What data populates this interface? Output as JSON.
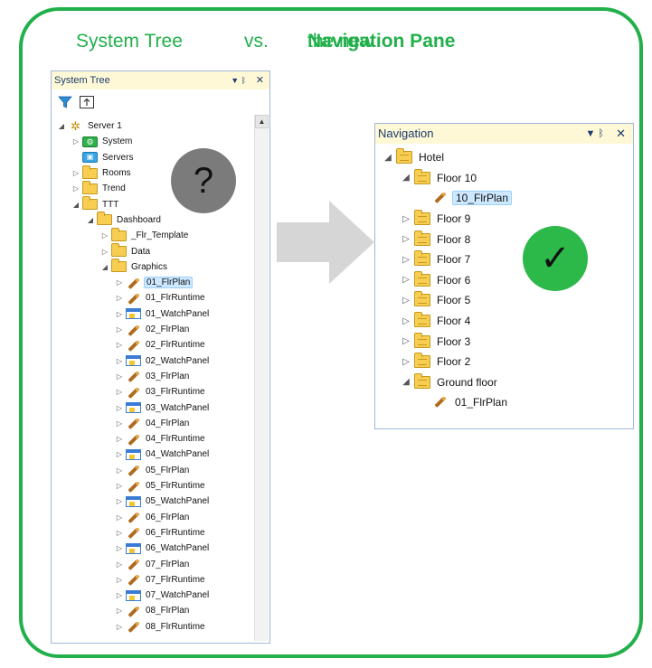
{
  "heading": {
    "left": "System Tree",
    "vs": "vs.",
    "right_prefix": "the new ",
    "right_bold": "Navigation Pane"
  },
  "colors": {
    "frame": "#22b04b",
    "check_badge": "#2db84a",
    "question_badge": "#7b7b7b",
    "arrow": "#d6d6d6"
  },
  "system_tree": {
    "title": "System Tree",
    "pin_glyph": "▼ ᛒ",
    "close_glyph": "✕",
    "toolbar": [
      {
        "icon": "filter-icon",
        "glyph": "▼"
      },
      {
        "icon": "export-icon",
        "glyph": "⇪"
      }
    ],
    "items": [
      {
        "label": "Server 1",
        "level": 0,
        "toggle": "◢",
        "icon": "server",
        "selected": false
      },
      {
        "label": "System",
        "level": 1,
        "toggle": "▷",
        "icon": "system",
        "selected": false
      },
      {
        "label": "Servers",
        "level": 1,
        "toggle": "",
        "icon": "servers",
        "selected": false
      },
      {
        "label": "Rooms",
        "level": 1,
        "toggle": "▷",
        "icon": "folder",
        "selected": false
      },
      {
        "label": "Trend",
        "level": 1,
        "toggle": "▷",
        "icon": "folder",
        "selected": false
      },
      {
        "label": "TTT",
        "level": 1,
        "toggle": "◢",
        "icon": "folder",
        "selected": false
      },
      {
        "label": "Dashboard",
        "level": 2,
        "toggle": "◢",
        "icon": "folder",
        "selected": false
      },
      {
        "label": "_Flr_Template",
        "level": 3,
        "toggle": "▷",
        "icon": "folder",
        "selected": false
      },
      {
        "label": "Data",
        "level": 3,
        "toggle": "▷",
        "icon": "folder",
        "selected": false
      },
      {
        "label": "Graphics",
        "level": 3,
        "toggle": "◢",
        "icon": "folder",
        "selected": false
      },
      {
        "label": "01_FlrPlan",
        "level": 4,
        "toggle": "▷",
        "icon": "plan",
        "selected": true
      },
      {
        "label": "01_FlrRuntime",
        "level": 4,
        "toggle": "▷",
        "icon": "plan",
        "selected": false
      },
      {
        "label": "01_WatchPanel",
        "level": 4,
        "toggle": "▷",
        "icon": "watch",
        "selected": false
      },
      {
        "label": "02_FlrPlan",
        "level": 4,
        "toggle": "▷",
        "icon": "plan",
        "selected": false
      },
      {
        "label": "02_FlrRuntime",
        "level": 4,
        "toggle": "▷",
        "icon": "plan",
        "selected": false
      },
      {
        "label": "02_WatchPanel",
        "level": 4,
        "toggle": "▷",
        "icon": "watch",
        "selected": false
      },
      {
        "label": "03_FlrPlan",
        "level": 4,
        "toggle": "▷",
        "icon": "plan",
        "selected": false
      },
      {
        "label": "03_FlrRuntime",
        "level": 4,
        "toggle": "▷",
        "icon": "plan",
        "selected": false
      },
      {
        "label": "03_WatchPanel",
        "level": 4,
        "toggle": "▷",
        "icon": "watch",
        "selected": false
      },
      {
        "label": "04_FlrPlan",
        "level": 4,
        "toggle": "▷",
        "icon": "plan",
        "selected": false
      },
      {
        "label": "04_FlrRuntime",
        "level": 4,
        "toggle": "▷",
        "icon": "plan",
        "selected": false
      },
      {
        "label": "04_WatchPanel",
        "level": 4,
        "toggle": "▷",
        "icon": "watch",
        "selected": false
      },
      {
        "label": "05_FlrPlan",
        "level": 4,
        "toggle": "▷",
        "icon": "plan",
        "selected": false
      },
      {
        "label": "05_FlrRuntime",
        "level": 4,
        "toggle": "▷",
        "icon": "plan",
        "selected": false
      },
      {
        "label": "05_WatchPanel",
        "level": 4,
        "toggle": "▷",
        "icon": "watch",
        "selected": false
      },
      {
        "label": "06_FlrPlan",
        "level": 4,
        "toggle": "▷",
        "icon": "plan",
        "selected": false
      },
      {
        "label": "06_FlrRuntime",
        "level": 4,
        "toggle": "▷",
        "icon": "plan",
        "selected": false
      },
      {
        "label": "06_WatchPanel",
        "level": 4,
        "toggle": "▷",
        "icon": "watch",
        "selected": false
      },
      {
        "label": "07_FlrPlan",
        "level": 4,
        "toggle": "▷",
        "icon": "plan",
        "selected": false
      },
      {
        "label": "07_FlrRuntime",
        "level": 4,
        "toggle": "▷",
        "icon": "plan",
        "selected": false
      },
      {
        "label": "07_WatchPanel",
        "level": 4,
        "toggle": "▷",
        "icon": "watch",
        "selected": false
      },
      {
        "label": "08_FlrPlan",
        "level": 4,
        "toggle": "▷",
        "icon": "plan",
        "selected": false
      },
      {
        "label": "08_FlrRuntime",
        "level": 4,
        "toggle": "▷",
        "icon": "plan",
        "selected": false
      }
    ]
  },
  "question_badge": {
    "text": "?"
  },
  "navigation": {
    "title": "Navigation",
    "pin_glyph": "▼ ᛒ",
    "close_glyph": "✕",
    "items": [
      {
        "label": "Hotel",
        "level": 0,
        "toggle": "◢",
        "icon": "folder",
        "selected": false
      },
      {
        "label": "Floor 10",
        "level": 1,
        "toggle": "◢",
        "icon": "folder",
        "selected": false
      },
      {
        "label": "10_FlrPlan",
        "level": 2,
        "toggle": "",
        "icon": "plan",
        "selected": true
      },
      {
        "label": "Floor 9",
        "level": 1,
        "toggle": "▷",
        "icon": "folder",
        "selected": false
      },
      {
        "label": "Floor 8",
        "level": 1,
        "toggle": "▷",
        "icon": "folder",
        "selected": false
      },
      {
        "label": "Floor 7",
        "level": 1,
        "toggle": "▷",
        "icon": "folder",
        "selected": false
      },
      {
        "label": "Floor 6",
        "level": 1,
        "toggle": "▷",
        "icon": "folder",
        "selected": false
      },
      {
        "label": "Floor 5",
        "level": 1,
        "toggle": "▷",
        "icon": "folder",
        "selected": false
      },
      {
        "label": "Floor 4",
        "level": 1,
        "toggle": "▷",
        "icon": "folder",
        "selected": false
      },
      {
        "label": "Floor 3",
        "level": 1,
        "toggle": "▷",
        "icon": "folder",
        "selected": false
      },
      {
        "label": "Floor 2",
        "level": 1,
        "toggle": "▷",
        "icon": "folder",
        "selected": false
      },
      {
        "label": "Ground floor",
        "level": 1,
        "toggle": "◢",
        "icon": "folder",
        "selected": false
      },
      {
        "label": "01_FlrPlan",
        "level": 2,
        "toggle": "",
        "icon": "plan",
        "selected": false
      }
    ]
  },
  "check_badge": {
    "text": "✓"
  }
}
